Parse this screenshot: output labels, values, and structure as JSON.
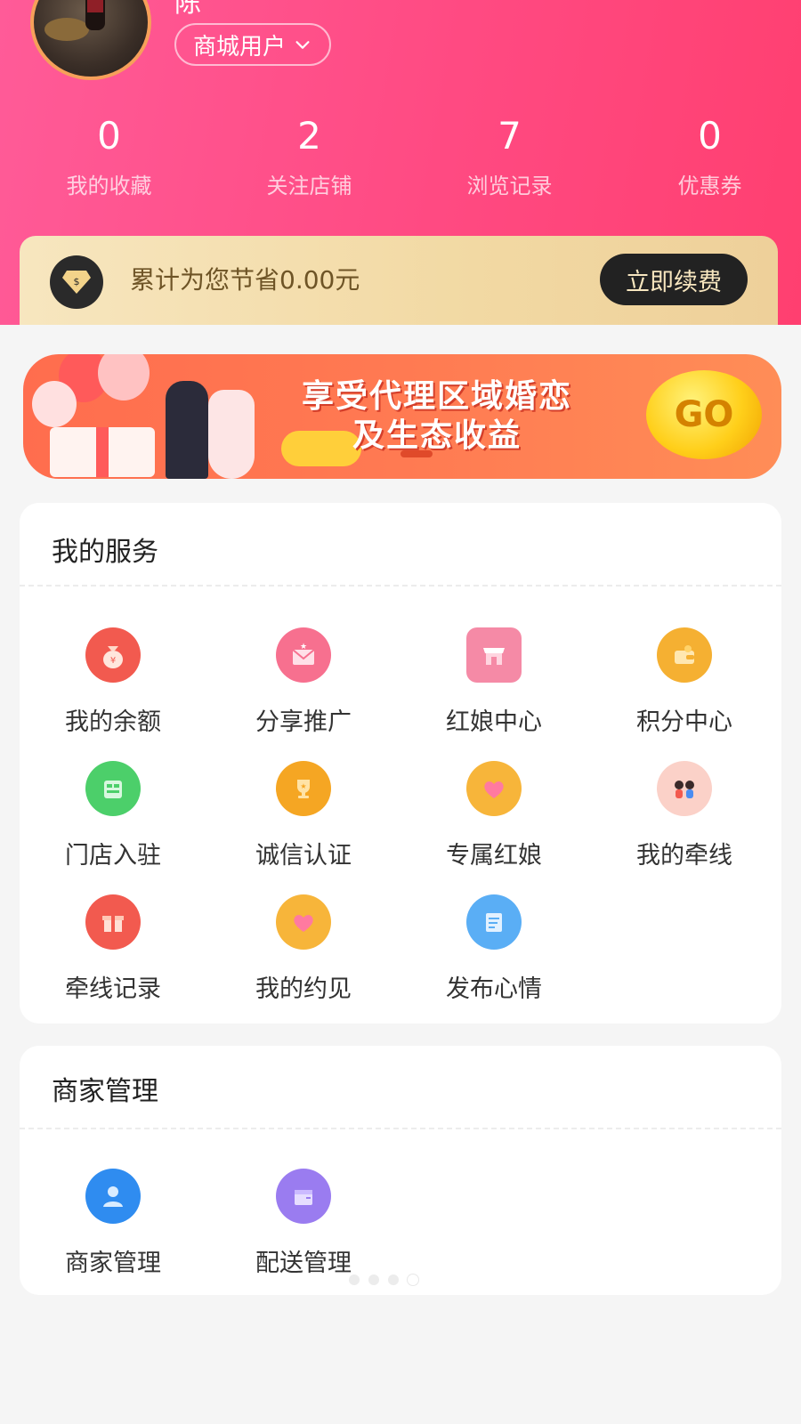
{
  "user": {
    "name_fragment": "陈",
    "role_tag": "商城用户"
  },
  "stats": [
    {
      "value": "0",
      "label": "我的收藏"
    },
    {
      "value": "2",
      "label": "关注店铺"
    },
    {
      "value": "7",
      "label": "浏览记录"
    },
    {
      "value": "0",
      "label": "优惠券"
    }
  ],
  "vip": {
    "text": "累计为您节省0.00元",
    "button": "立即续费"
  },
  "banner": {
    "line1": "享受代理区域婚恋",
    "line2": "及生态收益",
    "go": "GO"
  },
  "services": {
    "title": "我的服务",
    "items": [
      {
        "label": "我的余额",
        "icon": "money-bag-icon",
        "color": "#f25a4f"
      },
      {
        "label": "分享推广",
        "icon": "envelope-icon",
        "color": "#f7708f"
      },
      {
        "label": "红娘中心",
        "icon": "shop-icon",
        "color": "#f58aa6"
      },
      {
        "label": "积分中心",
        "icon": "wallet-icon",
        "color": "#f5b032"
      },
      {
        "label": "门店入驻",
        "icon": "store-icon",
        "color": "#4ccf6a"
      },
      {
        "label": "诚信认证",
        "icon": "trophy-icon",
        "color": "#f5a623"
      },
      {
        "label": "专属红娘",
        "icon": "heart-icon",
        "color": "#f7b53a"
      },
      {
        "label": "我的牵线",
        "icon": "couple-icon",
        "color": "#f56d7e"
      },
      {
        "label": "牵线记录",
        "icon": "gift-icon",
        "color": "#f25a4f"
      },
      {
        "label": "我的约见",
        "icon": "heart-icon",
        "color": "#f7b53a"
      },
      {
        "label": "发布心情",
        "icon": "note-icon",
        "color": "#5aaef5"
      }
    ]
  },
  "merchant": {
    "title": "商家管理",
    "items": [
      {
        "label": "商家管理",
        "icon": "person-icon",
        "color": "#2f8cf0"
      },
      {
        "label": "配送管理",
        "icon": "box-icon",
        "color": "#9a7cf0"
      }
    ]
  }
}
